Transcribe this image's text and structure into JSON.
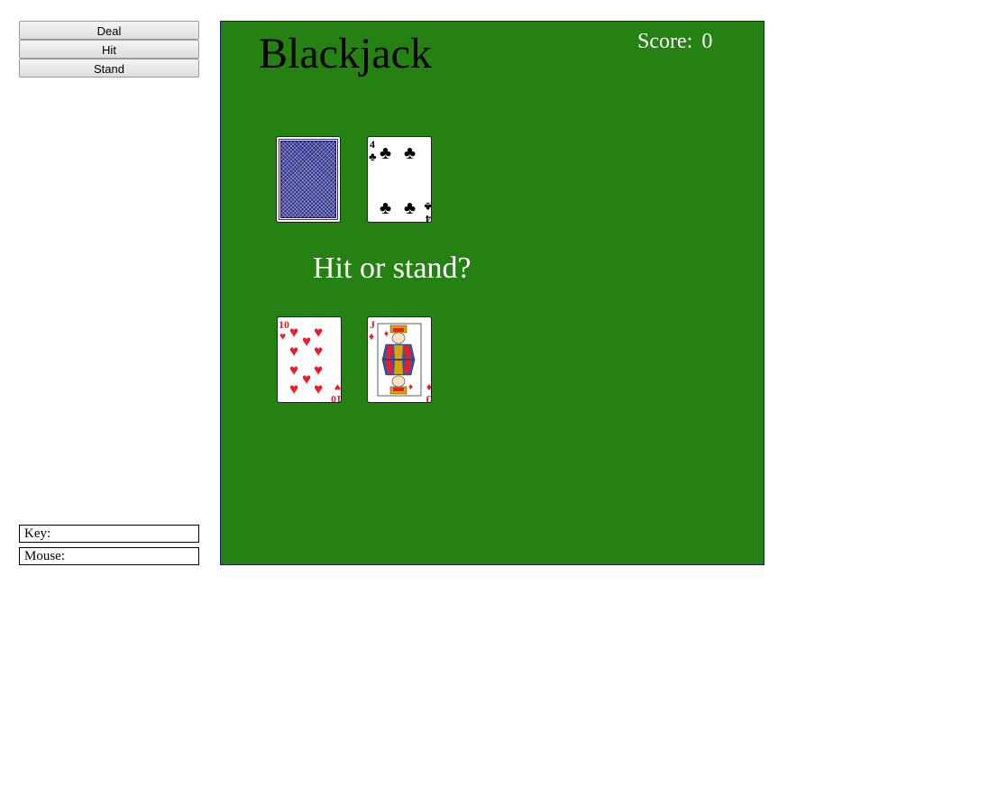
{
  "controls": {
    "deal_label": "Deal",
    "hit_label": "Hit",
    "stand_label": "Stand"
  },
  "status": {
    "key_label": "Key:",
    "mouse_label": "Mouse:"
  },
  "game": {
    "title": "Blackjack",
    "score_label": "Score:",
    "score_value": "0",
    "message": "Hit or stand?",
    "table_color": "#248112",
    "dealer_hand": [
      {
        "face": "down",
        "icon": "card-back-icon"
      },
      {
        "face": "up",
        "rank": "4",
        "suit": "clubs",
        "suit_symbol": "♣",
        "color": "#000000"
      }
    ],
    "player_hand": [
      {
        "face": "up",
        "rank": "10",
        "suit": "hearts",
        "suit_symbol": "♥",
        "color": "#ee1c24"
      },
      {
        "face": "up",
        "rank": "J",
        "suit": "diamonds",
        "suit_symbol": "♦",
        "color": "#ee1c24"
      }
    ]
  }
}
